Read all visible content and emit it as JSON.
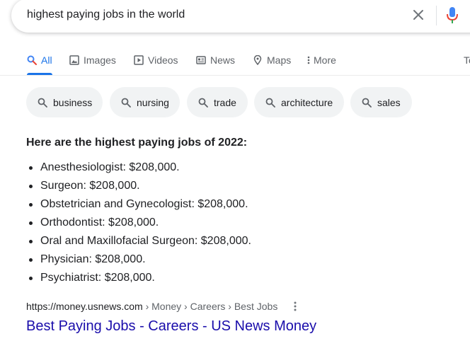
{
  "search": {
    "query": "highest paying jobs in the world"
  },
  "tabs": [
    {
      "label": "All",
      "icon": "search-icon",
      "active": true
    },
    {
      "label": "Images",
      "icon": "image-icon"
    },
    {
      "label": "Videos",
      "icon": "video-icon"
    },
    {
      "label": "News",
      "icon": "news-icon"
    },
    {
      "label": "Maps",
      "icon": "map-pin-icon"
    },
    {
      "label": "More",
      "icon": "more-vert-icon"
    },
    {
      "label": "To",
      "icon": ""
    }
  ],
  "chips": [
    "business",
    "nursing",
    "trade",
    "architecture",
    "sales"
  ],
  "snippet": {
    "heading": "Here are the highest paying jobs of 2022:",
    "items": [
      "Anesthesiologist: $208,000.",
      "Surgeon: $208,000.",
      "Obstetrician and Gynecologist: $208,000.",
      "Orthodontist: $208,000.",
      "Oral and Maxillofacial Surgeon: $208,000.",
      "Physician: $208,000.",
      "Psychiatrist: $208,000."
    ]
  },
  "result": {
    "url": "https://money.usnews.com",
    "breadcrumb": " › Money › Careers › Best Jobs",
    "title": "Best Paying Jobs - Careers - US News Money"
  },
  "colors": {
    "accent": "#1a73e8",
    "link": "#1a0dab",
    "chip_bg": "#f1f3f4",
    "text": "#202124",
    "muted": "#5f6368"
  }
}
